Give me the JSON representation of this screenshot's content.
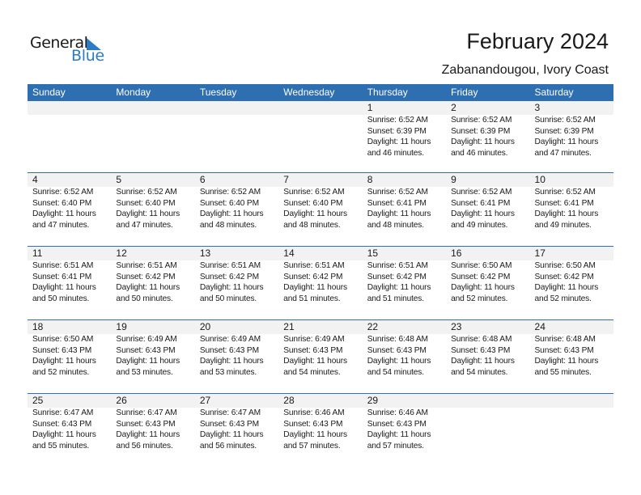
{
  "brand": {
    "line1": "General",
    "line2": "Blue",
    "accent_color": "#2c7bc4"
  },
  "header": {
    "title": "February 2024",
    "location": "Zabanandougou, Ivory Coast"
  },
  "theme": {
    "header_bg": "#2e6fb1",
    "week_bar_bg": "#f2f2f2"
  },
  "weekdays": [
    "Sunday",
    "Monday",
    "Tuesday",
    "Wednesday",
    "Thursday",
    "Friday",
    "Saturday"
  ],
  "weeks": [
    [
      null,
      null,
      null,
      null,
      {
        "day": "1",
        "sunrise": "Sunrise: 6:52 AM",
        "sunset": "Sunset: 6:39 PM",
        "daylight": "Daylight: 11 hours",
        "minutes": "and 46 minutes."
      },
      {
        "day": "2",
        "sunrise": "Sunrise: 6:52 AM",
        "sunset": "Sunset: 6:39 PM",
        "daylight": "Daylight: 11 hours",
        "minutes": "and 46 minutes."
      },
      {
        "day": "3",
        "sunrise": "Sunrise: 6:52 AM",
        "sunset": "Sunset: 6:39 PM",
        "daylight": "Daylight: 11 hours",
        "minutes": "and 47 minutes."
      }
    ],
    [
      {
        "day": "4",
        "sunrise": "Sunrise: 6:52 AM",
        "sunset": "Sunset: 6:40 PM",
        "daylight": "Daylight: 11 hours",
        "minutes": "and 47 minutes."
      },
      {
        "day": "5",
        "sunrise": "Sunrise: 6:52 AM",
        "sunset": "Sunset: 6:40 PM",
        "daylight": "Daylight: 11 hours",
        "minutes": "and 47 minutes."
      },
      {
        "day": "6",
        "sunrise": "Sunrise: 6:52 AM",
        "sunset": "Sunset: 6:40 PM",
        "daylight": "Daylight: 11 hours",
        "minutes": "and 48 minutes."
      },
      {
        "day": "7",
        "sunrise": "Sunrise: 6:52 AM",
        "sunset": "Sunset: 6:40 PM",
        "daylight": "Daylight: 11 hours",
        "minutes": "and 48 minutes."
      },
      {
        "day": "8",
        "sunrise": "Sunrise: 6:52 AM",
        "sunset": "Sunset: 6:41 PM",
        "daylight": "Daylight: 11 hours",
        "minutes": "and 48 minutes."
      },
      {
        "day": "9",
        "sunrise": "Sunrise: 6:52 AM",
        "sunset": "Sunset: 6:41 PM",
        "daylight": "Daylight: 11 hours",
        "minutes": "and 49 minutes."
      },
      {
        "day": "10",
        "sunrise": "Sunrise: 6:52 AM",
        "sunset": "Sunset: 6:41 PM",
        "daylight": "Daylight: 11 hours",
        "minutes": "and 49 minutes."
      }
    ],
    [
      {
        "day": "11",
        "sunrise": "Sunrise: 6:51 AM",
        "sunset": "Sunset: 6:41 PM",
        "daylight": "Daylight: 11 hours",
        "minutes": "and 50 minutes."
      },
      {
        "day": "12",
        "sunrise": "Sunrise: 6:51 AM",
        "sunset": "Sunset: 6:42 PM",
        "daylight": "Daylight: 11 hours",
        "minutes": "and 50 minutes."
      },
      {
        "day": "13",
        "sunrise": "Sunrise: 6:51 AM",
        "sunset": "Sunset: 6:42 PM",
        "daylight": "Daylight: 11 hours",
        "minutes": "and 50 minutes."
      },
      {
        "day": "14",
        "sunrise": "Sunrise: 6:51 AM",
        "sunset": "Sunset: 6:42 PM",
        "daylight": "Daylight: 11 hours",
        "minutes": "and 51 minutes."
      },
      {
        "day": "15",
        "sunrise": "Sunrise: 6:51 AM",
        "sunset": "Sunset: 6:42 PM",
        "daylight": "Daylight: 11 hours",
        "minutes": "and 51 minutes."
      },
      {
        "day": "16",
        "sunrise": "Sunrise: 6:50 AM",
        "sunset": "Sunset: 6:42 PM",
        "daylight": "Daylight: 11 hours",
        "minutes": "and 52 minutes."
      },
      {
        "day": "17",
        "sunrise": "Sunrise: 6:50 AM",
        "sunset": "Sunset: 6:42 PM",
        "daylight": "Daylight: 11 hours",
        "minutes": "and 52 minutes."
      }
    ],
    [
      {
        "day": "18",
        "sunrise": "Sunrise: 6:50 AM",
        "sunset": "Sunset: 6:43 PM",
        "daylight": "Daylight: 11 hours",
        "minutes": "and 52 minutes."
      },
      {
        "day": "19",
        "sunrise": "Sunrise: 6:49 AM",
        "sunset": "Sunset: 6:43 PM",
        "daylight": "Daylight: 11 hours",
        "minutes": "and 53 minutes."
      },
      {
        "day": "20",
        "sunrise": "Sunrise: 6:49 AM",
        "sunset": "Sunset: 6:43 PM",
        "daylight": "Daylight: 11 hours",
        "minutes": "and 53 minutes."
      },
      {
        "day": "21",
        "sunrise": "Sunrise: 6:49 AM",
        "sunset": "Sunset: 6:43 PM",
        "daylight": "Daylight: 11 hours",
        "minutes": "and 54 minutes."
      },
      {
        "day": "22",
        "sunrise": "Sunrise: 6:48 AM",
        "sunset": "Sunset: 6:43 PM",
        "daylight": "Daylight: 11 hours",
        "minutes": "and 54 minutes."
      },
      {
        "day": "23",
        "sunrise": "Sunrise: 6:48 AM",
        "sunset": "Sunset: 6:43 PM",
        "daylight": "Daylight: 11 hours",
        "minutes": "and 54 minutes."
      },
      {
        "day": "24",
        "sunrise": "Sunrise: 6:48 AM",
        "sunset": "Sunset: 6:43 PM",
        "daylight": "Daylight: 11 hours",
        "minutes": "and 55 minutes."
      }
    ],
    [
      {
        "day": "25",
        "sunrise": "Sunrise: 6:47 AM",
        "sunset": "Sunset: 6:43 PM",
        "daylight": "Daylight: 11 hours",
        "minutes": "and 55 minutes."
      },
      {
        "day": "26",
        "sunrise": "Sunrise: 6:47 AM",
        "sunset": "Sunset: 6:43 PM",
        "daylight": "Daylight: 11 hours",
        "minutes": "and 56 minutes."
      },
      {
        "day": "27",
        "sunrise": "Sunrise: 6:47 AM",
        "sunset": "Sunset: 6:43 PM",
        "daylight": "Daylight: 11 hours",
        "minutes": "and 56 minutes."
      },
      {
        "day": "28",
        "sunrise": "Sunrise: 6:46 AM",
        "sunset": "Sunset: 6:43 PM",
        "daylight": "Daylight: 11 hours",
        "minutes": "and 57 minutes."
      },
      {
        "day": "29",
        "sunrise": "Sunrise: 6:46 AM",
        "sunset": "Sunset: 6:43 PM",
        "daylight": "Daylight: 11 hours",
        "minutes": "and 57 minutes."
      },
      null,
      null
    ]
  ]
}
